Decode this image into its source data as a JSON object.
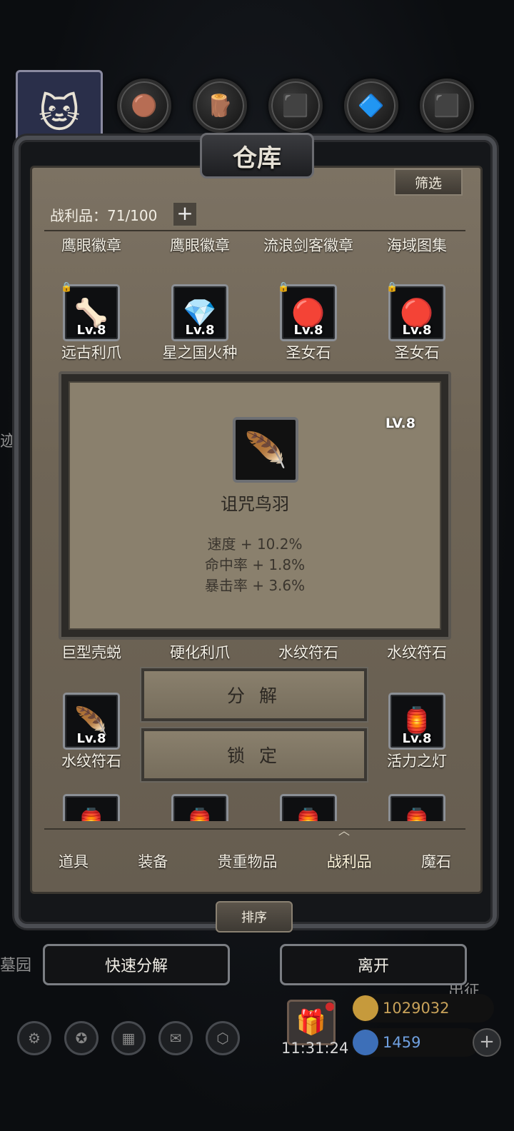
{
  "header": {
    "title": "仓库",
    "filter_label": "筛选",
    "capacity_label": "战利品：71/100",
    "plus_label": "+"
  },
  "top_orbs": [
    "avatar-icon",
    "ore-icon",
    "wood-icon",
    "stone-icon",
    "crystal-icon",
    "iron-icon"
  ],
  "row0_names": [
    "鹰眼徽章",
    "鹰眼徽章",
    "流浪剑客徽章",
    "海域图集"
  ],
  "row1": [
    {
      "name": "远古利爪",
      "level": "Lv.8",
      "icon": "claw-icon",
      "glyph": "🦴",
      "locked": true
    },
    {
      "name": "星之国火种",
      "level": "Lv.8",
      "icon": "purple-gem-icon",
      "glyph": "💎",
      "locked": false
    },
    {
      "name": "圣女石",
      "level": "Lv.8",
      "icon": "red-stone-icon",
      "glyph": "🔴",
      "locked": true
    },
    {
      "name": "圣女石",
      "level": "Lv.8",
      "icon": "red-stone-icon",
      "glyph": "🔴",
      "locked": true
    }
  ],
  "row2_names": [
    "巨型壳蜕",
    "硬化利爪",
    "水纹符石",
    "水纹符石"
  ],
  "row3": [
    {
      "name": "水纹符石",
      "level": "Lv.8",
      "icon": "blue-rune-icon",
      "glyph": "🪶"
    },
    {
      "name": "活力之灯",
      "level": "Lv.8",
      "icon": "lantern-icon",
      "glyph": "🏮"
    }
  ],
  "popup": {
    "name": "诅咒鸟羽",
    "level": "LV.8",
    "stats": [
      "速度 + 10.2%",
      "命中率 + 1.8%",
      "暴击率 + 3.6%"
    ],
    "icon_glyph": "🪶"
  },
  "actions": {
    "decompose": "分 解",
    "lock": "锁 定"
  },
  "tabs": [
    "道具",
    "装备",
    "贵重物品",
    "战利品",
    "魔石"
  ],
  "active_tab": "战利品",
  "sort_label": "排序",
  "quick_decompose_label": "快速分解",
  "leave_label": "离开",
  "background": {
    "left_text_1": "迹",
    "left_text_2": "墓园",
    "right_text": "出征",
    "gold": "1029032",
    "gems": "1459",
    "clock": "11:31:24"
  },
  "colors": {
    "parchment": "#7c7263",
    "popup_parchment": "#8a806d",
    "frame": "#4b4d52",
    "gold_text": "#c8a25a",
    "gem_text": "#6fa0e0"
  }
}
